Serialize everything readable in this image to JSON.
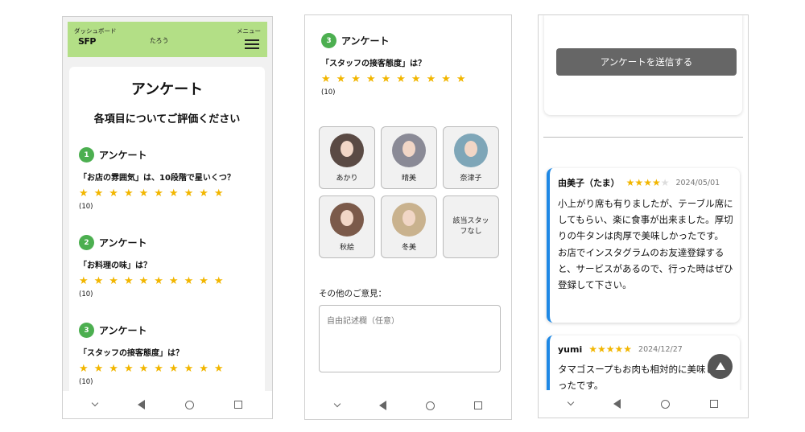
{
  "phone1": {
    "header": {
      "dashboard_label": "ダッシュボード",
      "logo": "SFP",
      "user_name": "たろう",
      "menu_label": "メニュー"
    },
    "title": "アンケート",
    "subtitle": "各項目についてご評価ください",
    "questions": [
      {
        "number": "1",
        "label": "アンケート",
        "text": "「お店の雰囲気」は、10段階で星いくつ？",
        "stars": "★★★★★★★★★★",
        "score": "(10)"
      },
      {
        "number": "2",
        "label": "アンケート",
        "text": "「お料理の味」は？",
        "stars": "★★★★★★★★★★",
        "score": "(10)"
      },
      {
        "number": "3",
        "label": "アンケート",
        "text": "「スタッフの接客態度」は？",
        "stars": "★★★★★★★★★★",
        "score": "(10)"
      }
    ]
  },
  "phone2": {
    "question": {
      "number": "3",
      "label": "アンケート",
      "text": "「スタッフの接客態度」は？",
      "stars": "★★★★★★★★★★",
      "score": "(10)"
    },
    "staff": [
      {
        "name": "あかり",
        "color": "#5a4a44"
      },
      {
        "name": "晴美",
        "color": "#8a8a96"
      },
      {
        "name": "奈津子",
        "color": "#7ea6b8"
      },
      {
        "name": "秋絵",
        "color": "#7b5a4a"
      },
      {
        "name": "冬美",
        "color": "#c9b28e"
      }
    ],
    "no_staff_label": "該当スタッフなし",
    "other_label": "その他のご意見：",
    "textarea_placeholder": "自由記述欄（任意）"
  },
  "phone3": {
    "submit_label": "アンケートを送信する",
    "reviews": [
      {
        "name": "由美子（たま）",
        "stars_on": "★★★★",
        "stars_off": "★",
        "date": "2024/05/01",
        "body": "小上がり席も有りましたが、テーブル席にしてもらい、楽に食事が出来ました。厚切りの牛タンは肉厚で美味しかったです。\nお店でインスタグラムのお友達登録すると、サービスがあるので、行った時はぜひ登録して下さい。"
      },
      {
        "name": "yumi",
        "stars_on": "★★★★★",
        "stars_off": "",
        "date": "2024/12/27",
        "body": "タマゴスープもお肉も相対的に美味しかったです。"
      }
    ]
  },
  "colors": {
    "header_green": "#b3df86",
    "step_green": "#4caf50",
    "star": "#f2b600",
    "accent_blue": "#1e88e5",
    "button_gray": "#666666"
  }
}
